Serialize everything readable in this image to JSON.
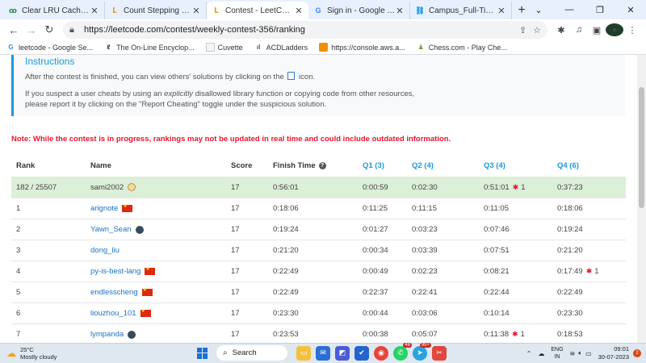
{
  "tabs": [
    {
      "title": "Clear LRU Cache in Pytho",
      "icon": "gfg-icon",
      "active": false
    },
    {
      "title": "Count Stepping Numbers",
      "icon": "leetcode-icon",
      "active": false
    },
    {
      "title": "Contest - LeetCode",
      "icon": "leetcode-icon",
      "active": true
    },
    {
      "title": "Sign in - Google Accoun",
      "icon": "google-icon",
      "active": false
    },
    {
      "title": "Campus_Full-Time_Techn",
      "icon": "link-icon",
      "active": false
    }
  ],
  "address": {
    "url": "https://leetcode.com/contest/weekly-contest-356/ranking"
  },
  "bookmarks": [
    {
      "label": "leetcode - Google Se...",
      "icon": "google-icon"
    },
    {
      "label": "The On-Line Encyclop...",
      "icon": "oeis-icon"
    },
    {
      "label": "Cuvette",
      "icon": "cuvette-icon"
    },
    {
      "label": "ACDLadders",
      "icon": "bar-chart-icon"
    },
    {
      "label": "https://console.aws.a...",
      "icon": "aws-icon"
    },
    {
      "label": "Chess.com - Play Che...",
      "icon": "chess-icon"
    }
  ],
  "instructions": {
    "title": "Instructions",
    "line1_pre": "After the contest is finished, you can view others' solutions by clicking on the",
    "line1_post": "icon.",
    "line2_pre": "If you suspect a user cheats by using an",
    "line2_em": "explicitly",
    "line2_post": "disallowed library function or copying code from other resources,",
    "line3": "please report it by clicking on the \"Report Cheating\" toggle under the suspicious solution."
  },
  "note": "Note: While the contest is in progress, rankings may not be updated in real time and could include outdated information.",
  "table": {
    "headers": {
      "rank": "Rank",
      "name": "Name",
      "score": "Score",
      "finish": "Finish Time",
      "q1": "Q1 (3)",
      "q2": "Q2 (4)",
      "q3": "Q3 (4)",
      "q4": "Q4 (6)"
    },
    "rows": [
      {
        "rank": "182 / 25507",
        "name": "sami2002",
        "score": "17",
        "finish": "0:56:01",
        "q1": "0:00:59",
        "q2": "0:02:30",
        "q3": "0:51:01",
        "q3_bugs": "1",
        "q4": "0:37:23",
        "q4_bugs": ""
      },
      {
        "rank": "1",
        "name": "arignote",
        "score": "17",
        "finish": "0:18:06",
        "q1": "0:11:25",
        "q2": "0:11:15",
        "q3": "0:11:05",
        "q3_bugs": "",
        "q4": "0:18:06",
        "q4_bugs": ""
      },
      {
        "rank": "2",
        "name": "Yawn_Sean",
        "score": "17",
        "finish": "0:19:24",
        "q1": "0:01:27",
        "q2": "0:03:23",
        "q3": "0:07:46",
        "q3_bugs": "",
        "q4": "0:19:24",
        "q4_bugs": ""
      },
      {
        "rank": "3",
        "name": "dong_liu",
        "score": "17",
        "finish": "0:21:20",
        "q1": "0:00:34",
        "q2": "0:03:39",
        "q3": "0:07:51",
        "q3_bugs": "",
        "q4": "0:21:20",
        "q4_bugs": ""
      },
      {
        "rank": "4",
        "name": "py-is-best-lang",
        "score": "17",
        "finish": "0:22:49",
        "q1": "0:00:49",
        "q2": "0:02:23",
        "q3": "0:08:21",
        "q3_bugs": "",
        "q4": "0:17:49",
        "q4_bugs": "1"
      },
      {
        "rank": "5",
        "name": "endlesscheng",
        "score": "17",
        "finish": "0:22:49",
        "q1": "0:22:37",
        "q2": "0:22:41",
        "q3": "0:22:44",
        "q3_bugs": "",
        "q4": "0:22:49",
        "q4_bugs": ""
      },
      {
        "rank": "6",
        "name": "liouzhou_101",
        "score": "17",
        "finish": "0:23:30",
        "q1": "0:00:44",
        "q2": "0:03:06",
        "q3": "0:10:14",
        "q3_bugs": "",
        "q4": "0:23:30",
        "q4_bugs": ""
      },
      {
        "rank": "7",
        "name": "lympanda",
        "score": "17",
        "finish": "0:23:53",
        "q1": "0:00:38",
        "q2": "0:05:07",
        "q3": "0:11:38",
        "q3_bugs": "1",
        "q4": "0:18:53",
        "q4_bugs": ""
      }
    ]
  },
  "taskbar": {
    "temp": "25°C",
    "condition": "Mostly cloudy",
    "search": "Search",
    "whatsapp_count": "46",
    "telegram_count": "99+",
    "lang": "ENG",
    "region": "IN",
    "time": "09:01",
    "date": "30-07-2023",
    "notifications": "2"
  }
}
